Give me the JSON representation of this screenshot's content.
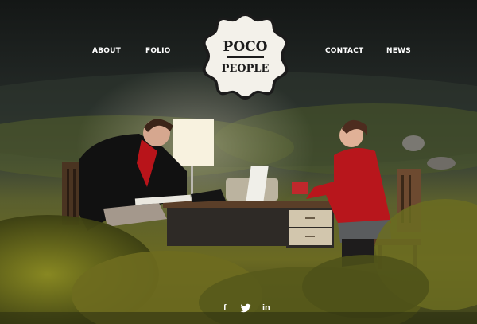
{
  "nav": {
    "items": [
      {
        "label": "ABOUT"
      },
      {
        "label": "FOLIO"
      },
      {
        "label": "CONTACT"
      },
      {
        "label": "NEWS"
      }
    ]
  },
  "logo": {
    "line1": "POCO",
    "line2": "PEOPLE"
  },
  "social": {
    "facebook": "f",
    "linkedin": "in",
    "icons": [
      "facebook-icon",
      "twitter-icon",
      "linkedin-icon"
    ]
  },
  "colors": {
    "sky": "#1a1d1c",
    "hillside": "#3d4a3c",
    "foliage": "#7c7e23",
    "jacket_red": "#b3181c",
    "lamp": "#f7f1df",
    "nav_text": "#ffffff"
  }
}
